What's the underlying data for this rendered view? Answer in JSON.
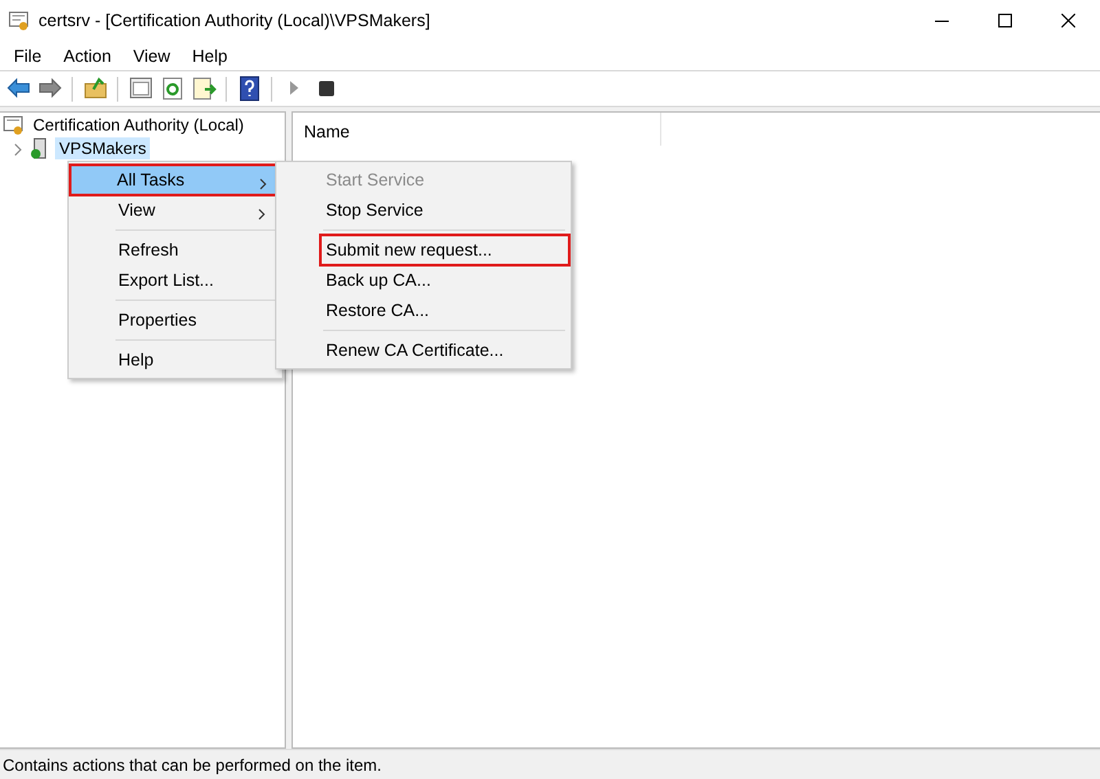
{
  "window": {
    "title": "certsrv - [Certification Authority (Local)\\VPSMakers]"
  },
  "menu_bar": [
    "File",
    "Action",
    "View",
    "Help"
  ],
  "toolbar": [
    {
      "kind": "back"
    },
    {
      "kind": "forward"
    },
    {
      "kind": "sep"
    },
    {
      "kind": "up"
    },
    {
      "kind": "sep"
    },
    {
      "kind": "console"
    },
    {
      "kind": "refresh"
    },
    {
      "kind": "export"
    },
    {
      "kind": "sep"
    },
    {
      "kind": "help"
    },
    {
      "kind": "sep"
    },
    {
      "kind": "play"
    },
    {
      "kind": "stop"
    }
  ],
  "tree": [
    {
      "label": "Certification Authority (Local)",
      "selected": false,
      "children": [
        {
          "label": "VPSMakers",
          "expanded": false,
          "selected": true
        }
      ]
    }
  ],
  "list": {
    "columns": [
      "Name"
    ]
  },
  "context_menu": [
    {
      "kind": "item",
      "label": "All Tasks",
      "submenu": true,
      "selected": true,
      "highlighted": true
    },
    {
      "kind": "item",
      "label": "View",
      "submenu": true,
      "selected": false,
      "highlighted": false
    },
    {
      "kind": "separator"
    },
    {
      "kind": "item",
      "label": "Refresh",
      "submenu": false,
      "selected": false,
      "highlighted": false
    },
    {
      "kind": "item",
      "label": "Export List...",
      "submenu": false,
      "selected": false,
      "highlighted": false
    },
    {
      "kind": "separator"
    },
    {
      "kind": "item",
      "label": "Properties",
      "submenu": false,
      "selected": false,
      "highlighted": false
    },
    {
      "kind": "separator"
    },
    {
      "kind": "item",
      "label": "Help",
      "submenu": false,
      "selected": false,
      "highlighted": false
    }
  ],
  "submenu": [
    {
      "kind": "item",
      "label": "Start Service",
      "disabled": true,
      "highlighted": false
    },
    {
      "kind": "item",
      "label": "Stop Service",
      "disabled": false,
      "highlighted": false
    },
    {
      "kind": "separator"
    },
    {
      "kind": "item",
      "label": "Submit new request...",
      "disabled": false,
      "highlighted": true
    },
    {
      "kind": "item",
      "label": "Back up CA...",
      "disabled": false,
      "highlighted": false
    },
    {
      "kind": "item",
      "label": "Restore CA...",
      "disabled": false,
      "highlighted": false
    },
    {
      "kind": "separator"
    },
    {
      "kind": "item",
      "label": "Renew CA Certificate...",
      "disabled": false,
      "highlighted": false
    }
  ],
  "status_bar": "Contains actions that can be performed on the item."
}
